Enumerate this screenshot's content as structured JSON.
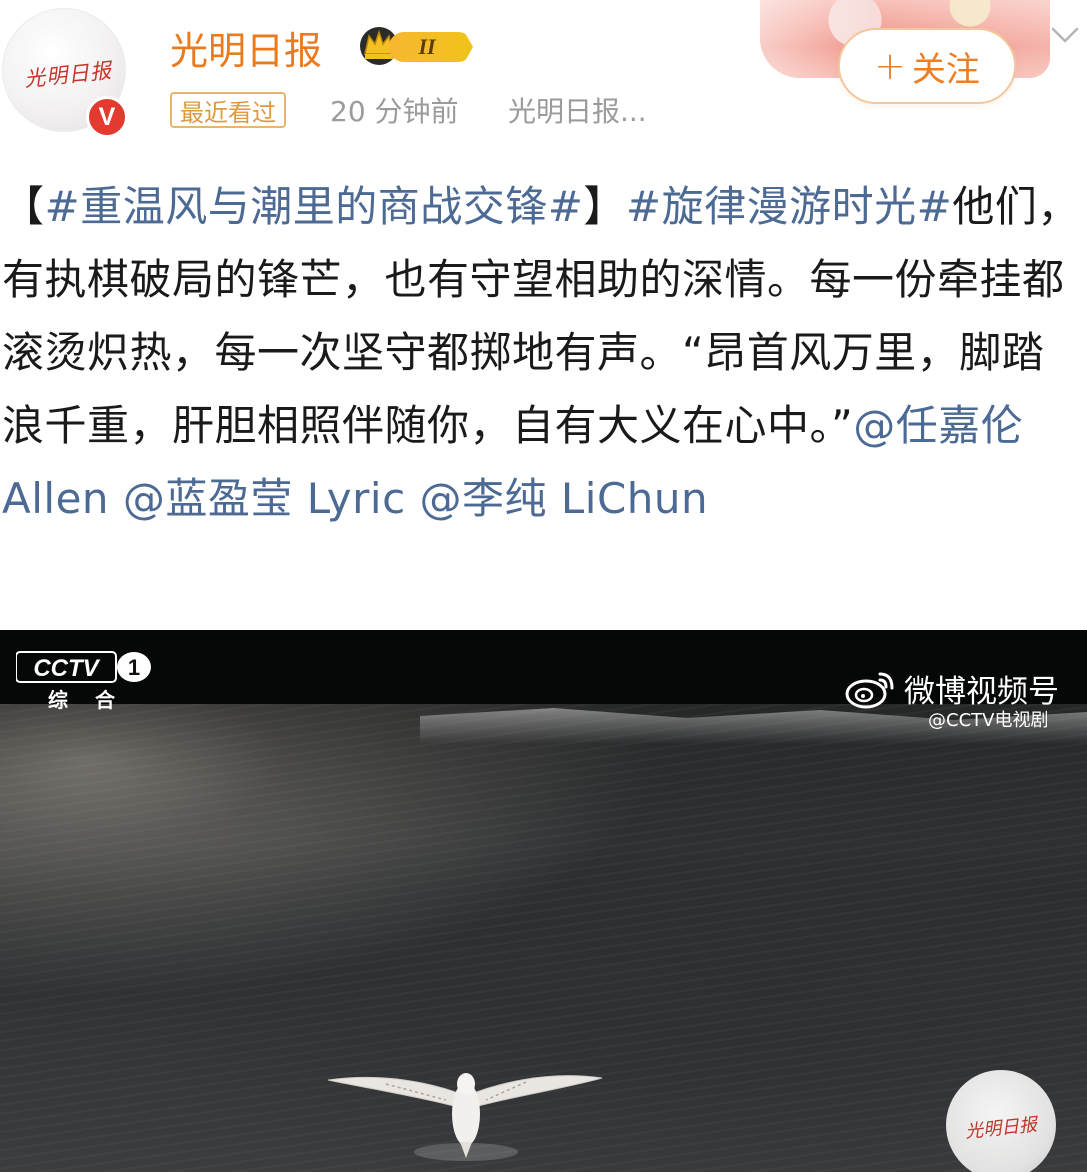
{
  "account": {
    "name": "光明日报",
    "avatar_text": "光明日报",
    "verified_mark": "V",
    "vip_level": "II",
    "recent_tag": "最近看过",
    "time": "20 分钟前",
    "source": "光明日报...",
    "follow_plus": "+",
    "follow_label": "关注"
  },
  "post": {
    "bracket_open": "【",
    "hashtag_1": "#重温风与潮里的商战交锋#",
    "bracket_close": "】",
    "hashtag_2": "#旋律漫游时光#",
    "text": "他们，有执棋破局的锋芒，也有守望相助的深情。每一份牵挂都滚烫炽热，每一次坚守都掷地有声。“昂首风万里，脚踏浪千重，肝胆相照伴随你，自有大义在心中。”",
    "mention_1": "@任嘉伦 Allen",
    "mention_2": "@蓝盈莹 Lyric",
    "mention_3": "@李纯 LiChun"
  },
  "video": {
    "cctv_text": "CCTV",
    "cctv_channel_number": "1",
    "channel_label": "综 合",
    "weibo_channel_label": "微博视频号",
    "weibo_handle": "@CCTV电视剧",
    "watermark_text": "光明日报"
  },
  "colors": {
    "account_name": "#eb7a1d",
    "link_blue": "#4c6a93",
    "follow_orange": "#ee7e22",
    "verified_red": "#e33b2f"
  },
  "icons": {
    "vip": "crown-vip-icon",
    "follow": "plus-icon",
    "menu": "chevron-down-icon",
    "weibo": "weibo-logo-icon"
  }
}
